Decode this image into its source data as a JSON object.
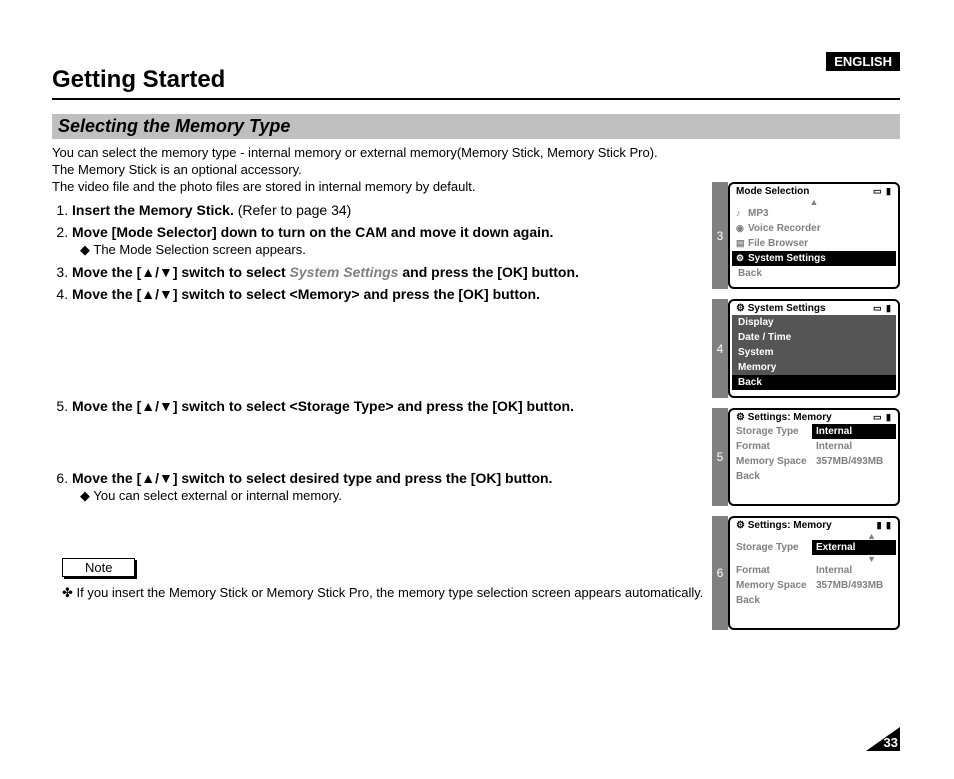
{
  "language_badge": "ENGLISH",
  "title": "Getting Started",
  "section_heading": "Selecting the Memory Type",
  "intro": {
    "line1": "You can select the memory type - internal memory or external memory(Memory Stick, Memory Stick Pro).",
    "line2": "The Memory Stick is an optional accessory.",
    "line3": "The video file and the photo files are stored in internal memory by default."
  },
  "steps": {
    "s1_bold": "Insert the Memory Stick.",
    "s1_rest": " (Refer to page 34)",
    "s2": "Move [Mode Selector] down to turn on the CAM and move it down again.",
    "s2_sub": "◆ The Mode Selection screen appears.",
    "s3_pre": "Move the [▲/▼] switch to select ",
    "s3_gray": "System Settings",
    "s3_post": " and press the [OK] button.",
    "s4": "Move the [▲/▼] switch to select <Memory> and press the [OK] button.",
    "s5": "Move the [▲/▼] switch to select <Storage Type> and press the [OK] button.",
    "s6": "Move the [▲/▼] switch to select desired type and press the [OK] button.",
    "s6_sub": "◆ You can select external or internal memory."
  },
  "note_label": "Note",
  "note_text": "✤   If you insert the Memory Stick or Memory Stick Pro, the memory type selection screen appears automatically.",
  "page_number": "33",
  "screens": {
    "s3": {
      "num": "3",
      "title": "Mode Selection",
      "items": [
        "MP3",
        "Voice Recorder",
        "File Browser",
        "System Settings",
        "Back"
      ],
      "icons": [
        "♪",
        "🎤",
        "⌸",
        "⚙",
        ""
      ]
    },
    "s4": {
      "num": "4",
      "title": "System Settings",
      "items": [
        "Display",
        "Date / Time",
        "System",
        "Memory",
        "Back"
      ]
    },
    "s5": {
      "num": "5",
      "title": "Settings: Memory",
      "rows": [
        {
          "k": "Storage Type",
          "v": "Internal"
        },
        {
          "k": "Format",
          "v": "Internal"
        },
        {
          "k": "Memory Space",
          "v": "357MB/493MB"
        },
        {
          "k": "Back",
          "v": ""
        }
      ]
    },
    "s6": {
      "num": "6",
      "title": "Settings: Memory",
      "rows": [
        {
          "k": "Storage Type",
          "v": "External"
        },
        {
          "k": "Format",
          "v": "Internal"
        },
        {
          "k": "Memory Space",
          "v": "357MB/493MB"
        },
        {
          "k": "Back",
          "v": ""
        }
      ]
    }
  }
}
